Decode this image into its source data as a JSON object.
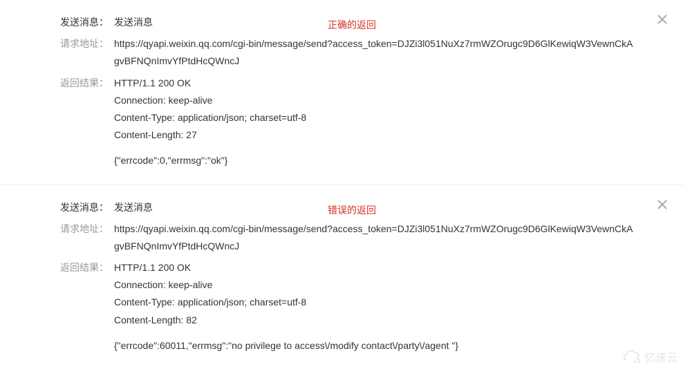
{
  "panels": [
    {
      "send_label": "发送消息：",
      "send_value": "发送消息",
      "annotation": "正确的返回",
      "url_label": "请求地址：",
      "url_value": "https://qyapi.weixin.qq.com/cgi-bin/message/send?access_token=DJZi3l051NuXz7rmWZOrugc9D6GlKewiqW3VewnCkAgvBFNQnImvYfPtdHcQWncJ",
      "result_label": "返回结果：",
      "result_headers": "HTTP/1.1 200 OK\nConnection: keep-alive\nContent-Type: application/json; charset=utf-8\nContent-Length: 27",
      "result_body": "{\"errcode\":0,\"errmsg\":\"ok\"}"
    },
    {
      "send_label": "发送消息：",
      "send_value": "发送消息",
      "annotation": "错误的返回",
      "url_label": "请求地址：",
      "url_value": "https://qyapi.weixin.qq.com/cgi-bin/message/send?access_token=DJZi3l051NuXz7rmWZOrugc9D6GlKewiqW3VewnCkAgvBFNQnImvYfPtdHcQWncJ",
      "result_label": "返回结果：",
      "result_headers": "HTTP/1.1 200 OK\nConnection: keep-alive\nContent-Type: application/json; charset=utf-8\nContent-Length: 82",
      "result_body": "{\"errcode\":60011,\"errmsg\":\"no privilege to access\\/modify contact\\/party\\/agent \"}"
    }
  ],
  "watermark_text": "亿速云"
}
